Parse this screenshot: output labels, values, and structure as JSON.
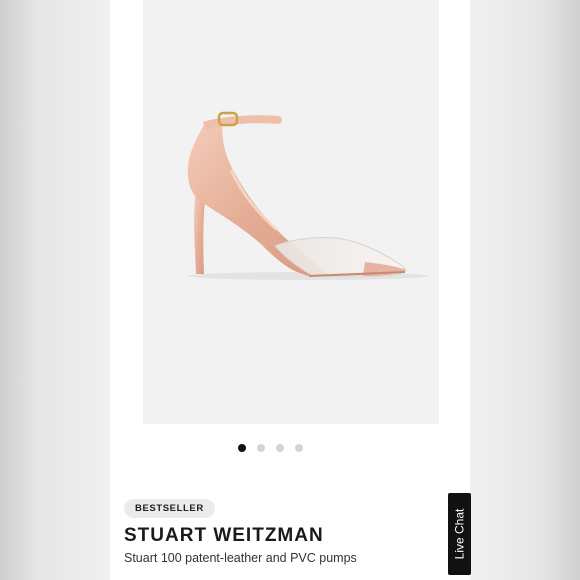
{
  "gallery": {
    "image_description": "rose gold patent pump with clear PVC vamp",
    "dot_count": 4,
    "active_index": 0
  },
  "product": {
    "badge": "BESTSELLER",
    "brand": "STUART WEITZMAN",
    "name": "Stuart 100 patent-leather and PVC pumps"
  },
  "live_chat": {
    "label": "Live Chat"
  },
  "colors": {
    "shoe": "#e8b5a0",
    "background": "#f2f2f2",
    "dot_active": "#111111",
    "dot_inactive": "#d4d4d4"
  }
}
